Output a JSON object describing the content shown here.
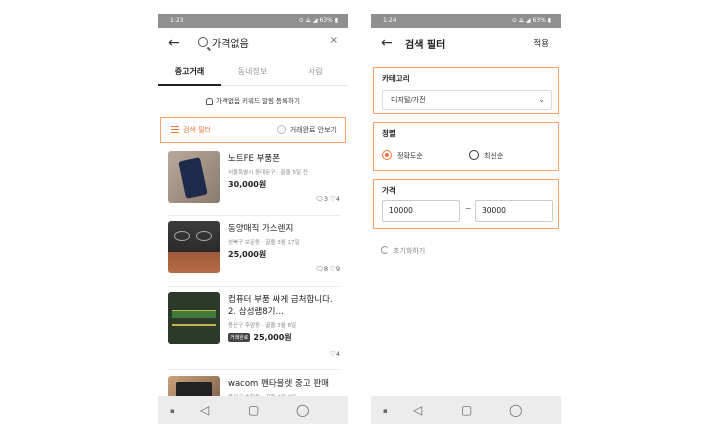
{
  "left": {
    "status": {
      "time": "1:23",
      "right": "⊙ ⟁ ◢ 63% ▮"
    },
    "search": {
      "back": "←",
      "query": "가격없음",
      "clear": "×"
    },
    "tabs": [
      "중고거래",
      "동네정보",
      "사람"
    ],
    "alert": "가격없음 키워드 알림 등록하기",
    "filter": {
      "label": "검색 필터",
      "hide_completed": "거래완료 안보기"
    },
    "items": [
      {
        "title": "노트FE 부품폰",
        "meta": "서울특별시 동대문구 · 끌올 5일 전",
        "price": "30,000원",
        "badge": "",
        "chats": "3",
        "likes": "4"
      },
      {
        "title": "동양매직 가스렌지",
        "meta": "성북구 보문동 · 끌올 3월 17일",
        "price": "25,000원",
        "badge": "",
        "chats": "8",
        "likes": "9"
      },
      {
        "title": "컴퓨터 부품 싸게 급처합니다. 2. 삼성램8기…",
        "meta": "용산구 후암동 · 끌올 3월 8일",
        "price": "25,000원",
        "badge": "거래완료",
        "chats": "",
        "likes": "4"
      },
      {
        "title": "wacom 펜타블렛 중고 판매",
        "meta": "용산구 효창동 · 끌올 3월 7일",
        "price": "",
        "badge": "",
        "chats": "",
        "likes": ""
      }
    ],
    "nav": {
      "dot": "▪",
      "back": "◁",
      "home": "▢",
      "recent": "◯"
    }
  },
  "right": {
    "status": {
      "time": "1:24",
      "right": "⊙ ⟁ ◢ 63% ▮"
    },
    "header": {
      "back": "←",
      "title": "검색 필터",
      "apply": "적용"
    },
    "category": {
      "label": "카테고리",
      "value": "디지털/가전",
      "chevron": "⌄"
    },
    "sort": {
      "label": "정렬",
      "options": [
        "정확도순",
        "최신순"
      ],
      "selected": 0
    },
    "price": {
      "label": "가격",
      "min": "10000",
      "max": "30000",
      "tilde": "~"
    },
    "reset": "초기화하기",
    "nav": {
      "dot": "▪",
      "back": "◁",
      "home": "▢",
      "recent": "◯"
    }
  },
  "colors": {
    "accent": "#ee7a3b",
    "highlight_border": "#f3a36b"
  }
}
